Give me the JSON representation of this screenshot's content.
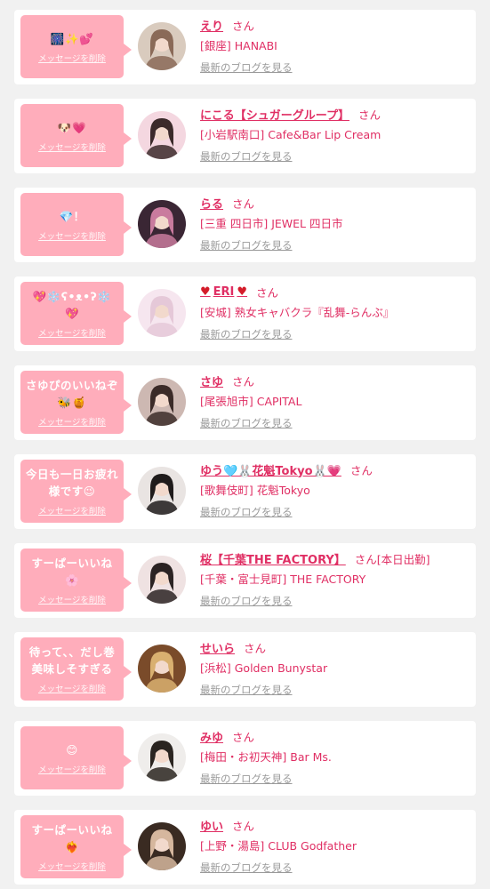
{
  "labels": {
    "delete_message": "メッセージを削除",
    "latest_blog": "最新のブログを見る",
    "honorific": "さん"
  },
  "colors": {
    "bubble": "#ffadbb",
    "accent": "#e02f64",
    "muted": "#9a9a9a"
  },
  "items": [
    {
      "message": "🎆✨💕",
      "name": "えり",
      "attendance": "",
      "area": "[銀座]",
      "shop": "HANABI",
      "avatar_palette": [
        "#d9cbbe",
        "#8a6a58"
      ]
    },
    {
      "message": "🐶💗",
      "name": "にこる【シュガーグループ】",
      "attendance": "",
      "area": "[小岩駅南口]",
      "shop": "Cafe&Bar Lip Cream",
      "avatar_palette": [
        "#f4d7e0",
        "#3b2a2a"
      ]
    },
    {
      "message": "💎！",
      "name": "らる",
      "attendance": "",
      "area": "[三重 四日市]",
      "shop": "JEWEL 四日市",
      "avatar_palette": [
        "#3a2634",
        "#c97b9e"
      ]
    },
    {
      "message": "💖❄️ʕ•ᴥ•ʔ❄️💖",
      "name": "ERI",
      "name_decor": "♥",
      "attendance": "",
      "area": "[安城]",
      "shop": "熟女キャバクラ『乱舞-らんぶ』",
      "avatar_palette": [
        "#f6e6ef",
        "#e5c8d8"
      ]
    },
    {
      "message": "さゆぴのいいねぞ🐝🍯",
      "name": "さゆ",
      "attendance": "",
      "area": "[尾張旭市]",
      "shop": "CAPITAL",
      "avatar_palette": [
        "#cdb8b2",
        "#3b2b28"
      ]
    },
    {
      "message": "今日も一日お疲れ様です😉",
      "name": "ゆう🩵🐰花魁Tokyo🐰💗",
      "attendance": "",
      "area": "[歌舞伎町]",
      "shop": "花魁Tokyo",
      "avatar_palette": [
        "#e9e4e2",
        "#1f1b1b"
      ]
    },
    {
      "message": "すーぱーいいね🌸",
      "name": "桜【千葉THE FACTORY】",
      "attendance": "[本日出勤]",
      "area": "[千葉・富士見町]",
      "shop": "THE FACTORY",
      "avatar_palette": [
        "#efe2e2",
        "#2b2323"
      ]
    },
    {
      "message": "待って、、だし巻美味しそすぎる",
      "name": "せいら",
      "attendance": "",
      "area": "[浜松]",
      "shop": "Golden Bunystar",
      "avatar_palette": [
        "#7a4b2a",
        "#d9b070"
      ]
    },
    {
      "message": "😊",
      "name": "みゆ",
      "attendance": "",
      "area": "[梅田・お初天神]",
      "shop": "Bar Ms.",
      "avatar_palette": [
        "#efedeb",
        "#2a2420"
      ]
    },
    {
      "message": "すーぱーいいね❤️‍🔥",
      "name": "ゆい",
      "attendance": "",
      "area": "[上野・湯島]",
      "shop": "CLUB Godfather",
      "avatar_palette": [
        "#3a2b22",
        "#d6b79e"
      ]
    }
  ]
}
